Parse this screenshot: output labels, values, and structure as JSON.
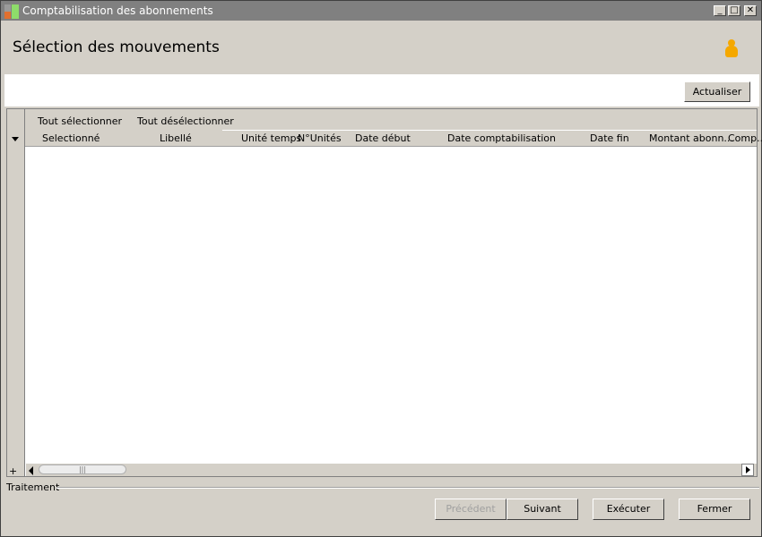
{
  "window": {
    "title": "Comptabilisation des abonnements",
    "controls": {
      "minimize": "_",
      "maximize": "□",
      "close": "✕"
    }
  },
  "header": {
    "title": "Sélection des mouvements",
    "icon": "user-icon"
  },
  "toolbar": {
    "refresh_label": "Actualiser"
  },
  "grid": {
    "select_all_label": "Tout sélectionner",
    "deselect_all_label": "Tout désélectionner",
    "columns": [
      "Selectionné",
      "Libellé",
      "Unité temps",
      "N°Unités",
      "Date début",
      "Date comptabilisation",
      "Date fin",
      "Montant abonn...",
      "Comp..."
    ],
    "rows": [],
    "add_row_label": "+",
    "scroll_thumb_grip": "|||"
  },
  "footer": {
    "section_label": "Traitement",
    "prev_label": "Précédent",
    "next_label": "Suivant",
    "execute_label": "Exécuter",
    "close_label": "Fermer"
  }
}
